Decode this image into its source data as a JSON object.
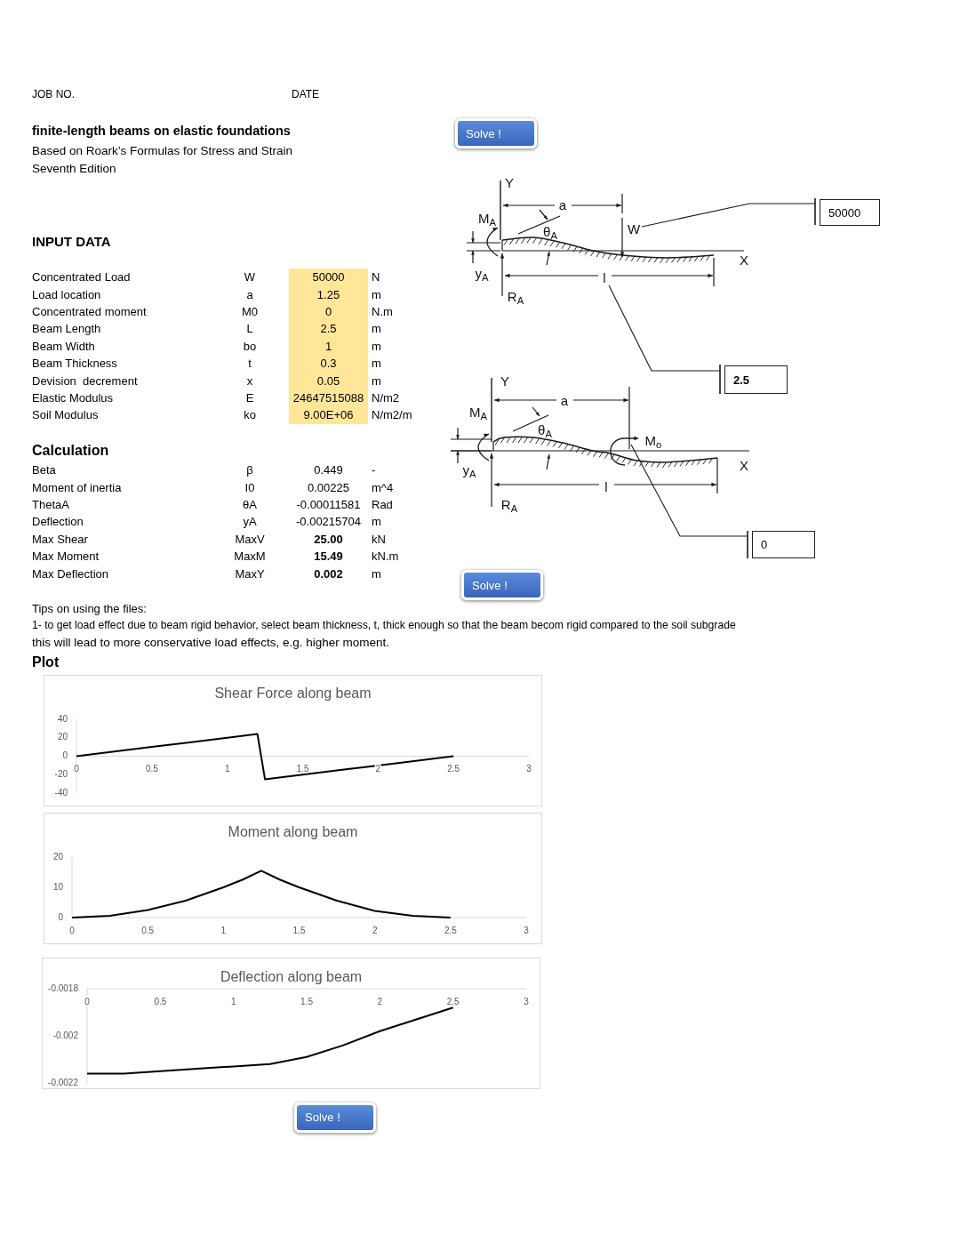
{
  "job_header": {
    "job_no_label": "JOB NO.",
    "date_label": "DATE"
  },
  "title": "finite-length beams on elastic foundations",
  "subtitle_lines": [
    "Based on Roark’s Formulas for Stress and Strain",
    "Seventh Edition"
  ],
  "solve_buttons": [
    {
      "label": "Solve !"
    },
    {
      "label": "Solve !"
    },
    {
      "label": "Solve !"
    }
  ],
  "diagrams": [
    {
      "kind": "point_load",
      "labels": {
        "y_axis": "Y",
        "dimension_a": "a",
        "end_moment": "M$_{A}$",
        "slope": "θ$_{A}$",
        "load": "W",
        "x_axis": "X",
        "deflection": "y$_{A}$",
        "dimension_l": "l",
        "reaction": "R$_{A}$"
      },
      "callouts": [
        {
          "value": "50000",
          "bold": false
        },
        {
          "value": "2.5",
          "bold": true
        }
      ]
    },
    {
      "kind": "point_moment",
      "labels": {
        "y_axis": "Y",
        "dimension_a": "a",
        "end_moment": "M$_{A}$",
        "slope": "θ$_{A}$",
        "applied_moment": "M$_{o}$",
        "x_axis": "X",
        "deflection": "y$_{A}$",
        "dimension_l": "l",
        "reaction": "R$_{A}$"
      },
      "callouts": [
        {
          "value": "0",
          "bold": false
        }
      ]
    }
  ],
  "input_data": {
    "heading": "INPUT DATA",
    "rows": [
      {
        "label": "Concentrated Load",
        "symbol": "W",
        "value": "50000",
        "unit": "N"
      },
      {
        "label": "Load location",
        "symbol": "a",
        "value": "1.25",
        "unit": "m"
      },
      {
        "label": "Concentrated moment",
        "symbol": "M0",
        "value": "0",
        "unit": "N.m"
      },
      {
        "label": "Beam Length",
        "symbol": "L",
        "value": "2.5",
        "unit": "m"
      },
      {
        "label": "Beam Width",
        "symbol": "bo",
        "value": "1",
        "unit": "m"
      },
      {
        "label": "Beam Thickness",
        "symbol": "t",
        "value": "0.3",
        "unit": "m"
      },
      {
        "label": "Devision  decrement",
        "symbol": "x",
        "value": "0.05",
        "unit": "m"
      },
      {
        "label": "Elastic Modulus",
        "symbol": "E",
        "value": "24647515088",
        "unit": "N/m2"
      },
      {
        "label": "Soil Modulus",
        "symbol": "ko",
        "value": "9.00E+06",
        "unit": "N/m2/m"
      }
    ]
  },
  "calculation": {
    "heading": "Calculation",
    "rows": [
      {
        "label": "Beta",
        "symbol": "β",
        "value": "0.449",
        "unit": "-",
        "emphasized": false
      },
      {
        "label": "Moment of inertia",
        "symbol": "I0",
        "value": "0.00225",
        "unit": "m^4",
        "emphasized": false
      },
      {
        "label": "ThetaA",
        "symbol": "θA",
        "value": "-0.00011581",
        "unit": "Rad",
        "emphasized": false
      },
      {
        "label": "Deflection",
        "symbol": "yA",
        "value": "-0.00215704",
        "unit": "m",
        "emphasized": false
      },
      {
        "label": "Max Shear",
        "symbol": "MaxV",
        "value": "25.00",
        "unit": "kN",
        "emphasized": true
      },
      {
        "label": "Max Moment",
        "symbol": "MaxM",
        "value": "15.49",
        "unit": "kN.m",
        "emphasized": true
      },
      {
        "label": "Max Deflection",
        "symbol": "MaxY",
        "value": "0.002",
        "unit": "m",
        "emphasized": true
      }
    ]
  },
  "tips": {
    "heading": "Tips on using the files:",
    "lines": [
      "1- to get load effect due to beam rigid behavior, select beam thickness, t, thick enough so that the beam becom rigid compared to the soil subgrade",
      "this will lead to more conservative load effects, e.g. higher moment."
    ]
  },
  "plot": {
    "heading": "Plot",
    "charts": [
      {
        "chart_data": {
          "type": "line",
          "title": "Shear Force along beam",
          "x": [
            0,
            0.25,
            0.5,
            0.75,
            1,
            1.2,
            1.25,
            1.5,
            1.75,
            2,
            2.25,
            2.5
          ],
          "values": [
            0,
            5,
            10,
            15,
            20,
            24,
            -25,
            -20,
            -15,
            -10,
            -5,
            0
          ],
          "xlim": [
            0,
            3
          ],
          "ylim": [
            -40,
            40
          ],
          "xticks": [
            0,
            0.5,
            1,
            1.5,
            2,
            2.5,
            3
          ],
          "yticks": [
            40,
            20,
            0,
            -20,
            -40
          ]
        }
      },
      {
        "chart_data": {
          "type": "line",
          "title": "Moment along beam",
          "x": [
            0,
            0.25,
            0.5,
            0.75,
            1,
            1.125,
            1.25,
            1.375,
            1.5,
            1.75,
            2,
            2.25,
            2.5
          ],
          "values": [
            0,
            0.6,
            2.5,
            5.6,
            10,
            12.5,
            15.5,
            12.5,
            10,
            5.6,
            2.2,
            0.6,
            0
          ],
          "xlim": [
            0,
            3
          ],
          "ylim": [
            0,
            20
          ],
          "xticks": [
            0,
            0.5,
            1,
            1.5,
            2,
            2.5,
            3
          ],
          "yticks": [
            20,
            10,
            0
          ]
        }
      },
      {
        "chart_data": {
          "type": "line",
          "title": "Deflection along beam",
          "x": [
            0,
            0.25,
            0.5,
            0.75,
            1,
            1.25,
            1.5,
            1.75,
            2,
            2.25,
            2.5
          ],
          "values": [
            -0.00216,
            -0.00216,
            -0.00215,
            -0.00214,
            -0.00213,
            -0.00212,
            -0.00209,
            -0.00204,
            -0.00198,
            -0.00193,
            -0.00188
          ],
          "xlim": [
            0,
            3
          ],
          "ylim": [
            -0.0022,
            -0.0018
          ],
          "xticks": [
            0,
            0.5,
            1,
            1.5,
            2,
            2.5,
            3
          ],
          "yticks": [
            -0.0018,
            -0.002,
            -0.0022
          ]
        }
      }
    ]
  }
}
